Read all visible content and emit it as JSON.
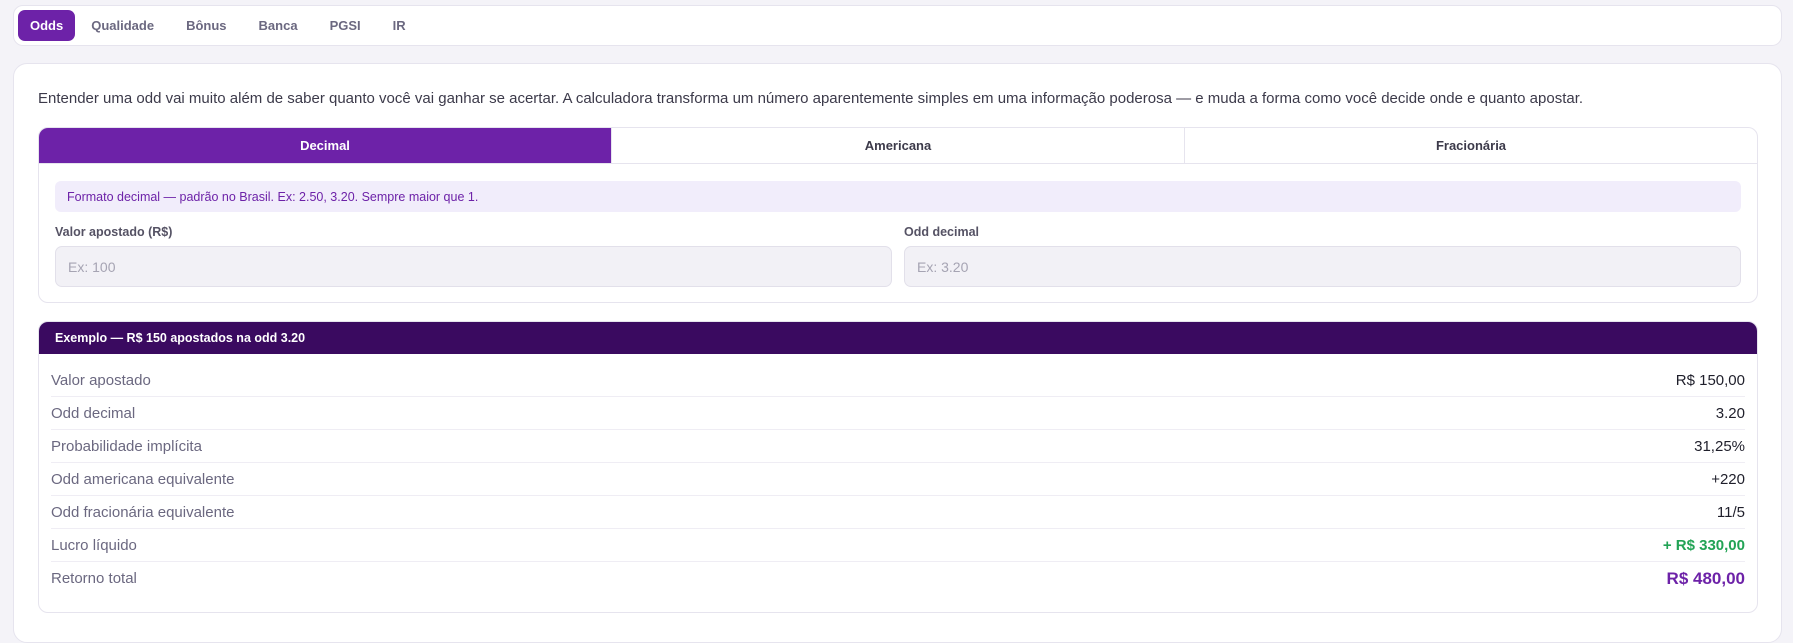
{
  "top_tabs": [
    "Odds",
    "Qualidade",
    "Bônus",
    "Banca",
    "PGSI",
    "IR"
  ],
  "intro": "Entender uma odd vai muito além de saber quanto você vai ganhar se acertar. A calculadora transforma um número aparentemente simples em uma informação poderosa — e muda a forma como você decide onde e quanto apostar.",
  "format_tabs": [
    "Decimal",
    "Americana",
    "Fracionária"
  ],
  "hint": "Formato decimal — padrão no Brasil. Ex: 2.50, 3.20. Sempre maior que 1.",
  "fields": {
    "stake_label": "Valor apostado (R$)",
    "stake_placeholder": "Ex: 100",
    "odd_label": "Odd decimal",
    "odd_placeholder": "Ex: 3.20"
  },
  "example": {
    "title": "Exemplo — R$ 150 apostados na odd 3.20",
    "rows": [
      {
        "label": "Valor apostado",
        "value": "R$ 150,00"
      },
      {
        "label": "Odd decimal",
        "value": "3.20"
      },
      {
        "label": "Probabilidade implícita",
        "value": "31,25%"
      },
      {
        "label": "Odd americana equivalente",
        "value": "+220"
      },
      {
        "label": "Odd fracionária equivalente",
        "value": "11/5"
      },
      {
        "label": "Lucro líquido",
        "value": "+ R$ 330,00"
      },
      {
        "label": "Retorno total",
        "value": "R$ 480,00"
      }
    ]
  },
  "colors": {
    "accent": "#6d22a8",
    "header_dark": "#3a0a60",
    "profit_green": "#22a355"
  }
}
